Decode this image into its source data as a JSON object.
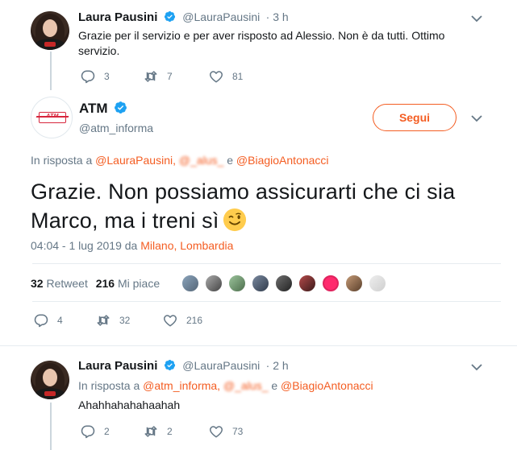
{
  "tweet1": {
    "name": "Laura Pausini",
    "handle": "@LauraPausini",
    "time": "· 3 h",
    "text": "Grazie per il servizio e per aver risposto ad Alessio. Non è da tutti. Ottimo servizio.",
    "replies": "3",
    "retweets": "7",
    "likes": "81"
  },
  "main_tweet": {
    "name": "ATM",
    "handle": "@atm_informa",
    "follow_label": "Segui",
    "reply_to_prefix": "In risposta a",
    "reply_to_user1": "@LauraPausini,",
    "reply_to_user2": "@_alus_",
    "reply_to_and": "e",
    "reply_to_user3": "@BiagioAntonacci",
    "text_line1": "Grazie. Non possiamo assicurarti che ci sia",
    "text_line2": "Marco, ma i treni sì",
    "datetime": "04:04 - 1 lug 2019 da",
    "location": "Milano, Lombardia",
    "retweet_count": "32",
    "retweet_label": "Retweet",
    "like_count": "216",
    "like_label": "Mi piace",
    "replies": "4",
    "retweets": "32",
    "likes": "216"
  },
  "tweet3": {
    "name": "Laura Pausini",
    "handle": "@LauraPausini",
    "time": "· 2 h",
    "reply_to_prefix": "In risposta a",
    "reply_to_user1": "@atm_informa,",
    "reply_to_user2": "@_alus_",
    "reply_to_and": "e",
    "reply_to_user3": "@BiagioAntonacci",
    "text": "Ahahhahahahaahah",
    "replies": "2",
    "retweets": "2",
    "likes": "73"
  },
  "colors": {
    "brand_orange": "#f45d22",
    "like_pink": "#e0245e",
    "verified_blue": "#1da1f2",
    "muted_gray": "#657786"
  },
  "icons": [
    "verified-badge-icon",
    "chevron-down-icon",
    "reply-icon",
    "retweet-icon",
    "like-icon",
    "wink-emoji-icon"
  ]
}
